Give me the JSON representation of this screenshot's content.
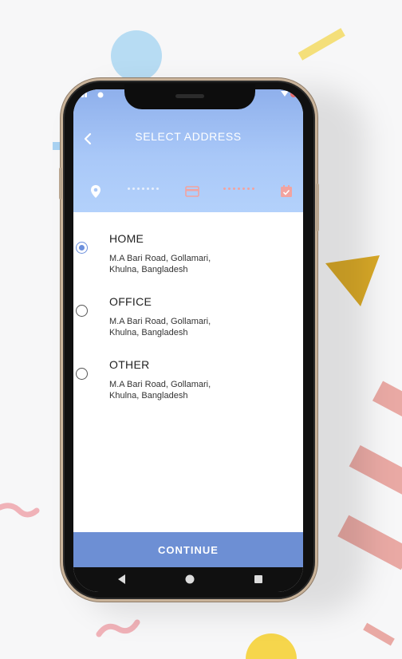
{
  "header": {
    "title": "SELECT ADDRESS",
    "back_icon": "chevron-left-icon",
    "steps": [
      {
        "icon": "location-pin-icon",
        "state": "active"
      },
      {
        "icon": "credit-card-icon",
        "state": "pending"
      },
      {
        "icon": "check-calendar-icon",
        "state": "pending"
      }
    ]
  },
  "addresses": [
    {
      "label": "HOME",
      "line1": "M.A Bari Road, Gollamari,",
      "line2": "Khulna, Bangladesh",
      "selected": true
    },
    {
      "label": "OFFICE",
      "line1": "M.A Bari Road, Gollamari,",
      "line2": "Khulna, Bangladesh",
      "selected": false
    },
    {
      "label": "OTHER",
      "line1": "M.A Bari Road, Gollamari,",
      "line2": "Khulna, Bangladesh",
      "selected": false
    }
  ],
  "footer": {
    "continue_label": "CONTINUE"
  },
  "navbar": {
    "back": "nav-back-icon",
    "home": "nav-home-icon",
    "recents": "nav-recents-icon"
  },
  "colors": {
    "header_top": "#8fb0ec",
    "header_bottom": "#b3d1fb",
    "accent": "#6d8fd4",
    "step_pending": "#f2a3a0"
  }
}
